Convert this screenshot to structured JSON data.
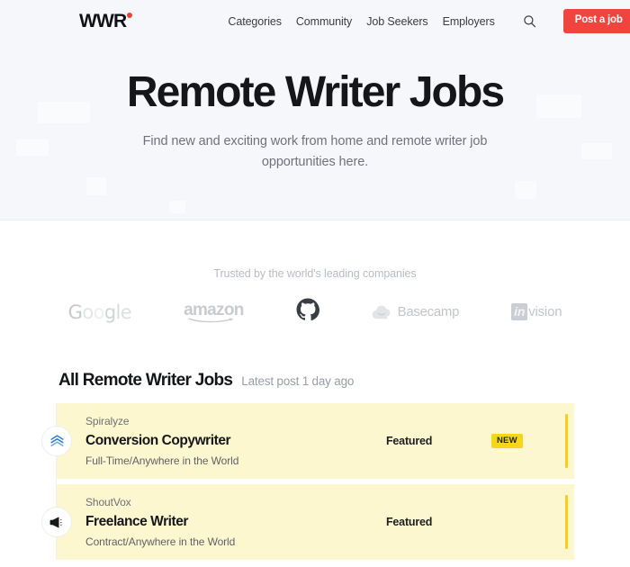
{
  "brand": {
    "logo_text": "WWR",
    "accent_color": "#ef4136"
  },
  "nav": {
    "items": [
      {
        "label": "Categories"
      },
      {
        "label": "Community"
      },
      {
        "label": "Job Seekers"
      },
      {
        "label": "Employers"
      }
    ],
    "search_icon": "search-icon",
    "cta_label": "Post a job",
    "cta_color": "#f0453f"
  },
  "hero": {
    "title": "Remote Writer Jobs",
    "subtitle": "Find new and exciting work from home and remote writer job opportunities here.",
    "background_color": "#f6f7fa"
  },
  "trusted": {
    "label": "Trusted by the world's leading companies",
    "companies": [
      {
        "name": "Google"
      },
      {
        "name": "amazon"
      },
      {
        "name": "GitHub"
      },
      {
        "name": "Basecamp"
      },
      {
        "name": "InVision"
      }
    ]
  },
  "jobs": {
    "heading": "All Remote Writer Jobs",
    "latest": "Latest post 1 day ago",
    "row_background": "#fdf7cf",
    "accent_color": "#f5cf1c",
    "items": [
      {
        "company": "Spiralyze",
        "title": "Conversion Copywriter",
        "meta": "Full-Time/Anywhere in the World",
        "featured": "Featured",
        "badge": "NEW",
        "logo_icon": "spiralyze-chevrons-icon"
      },
      {
        "company": "ShoutVox",
        "title": "Freelance Writer",
        "meta": "Contract/Anywhere in the World",
        "featured": "Featured",
        "badge": "",
        "logo_icon": "shoutvox-megaphone-icon"
      }
    ]
  }
}
